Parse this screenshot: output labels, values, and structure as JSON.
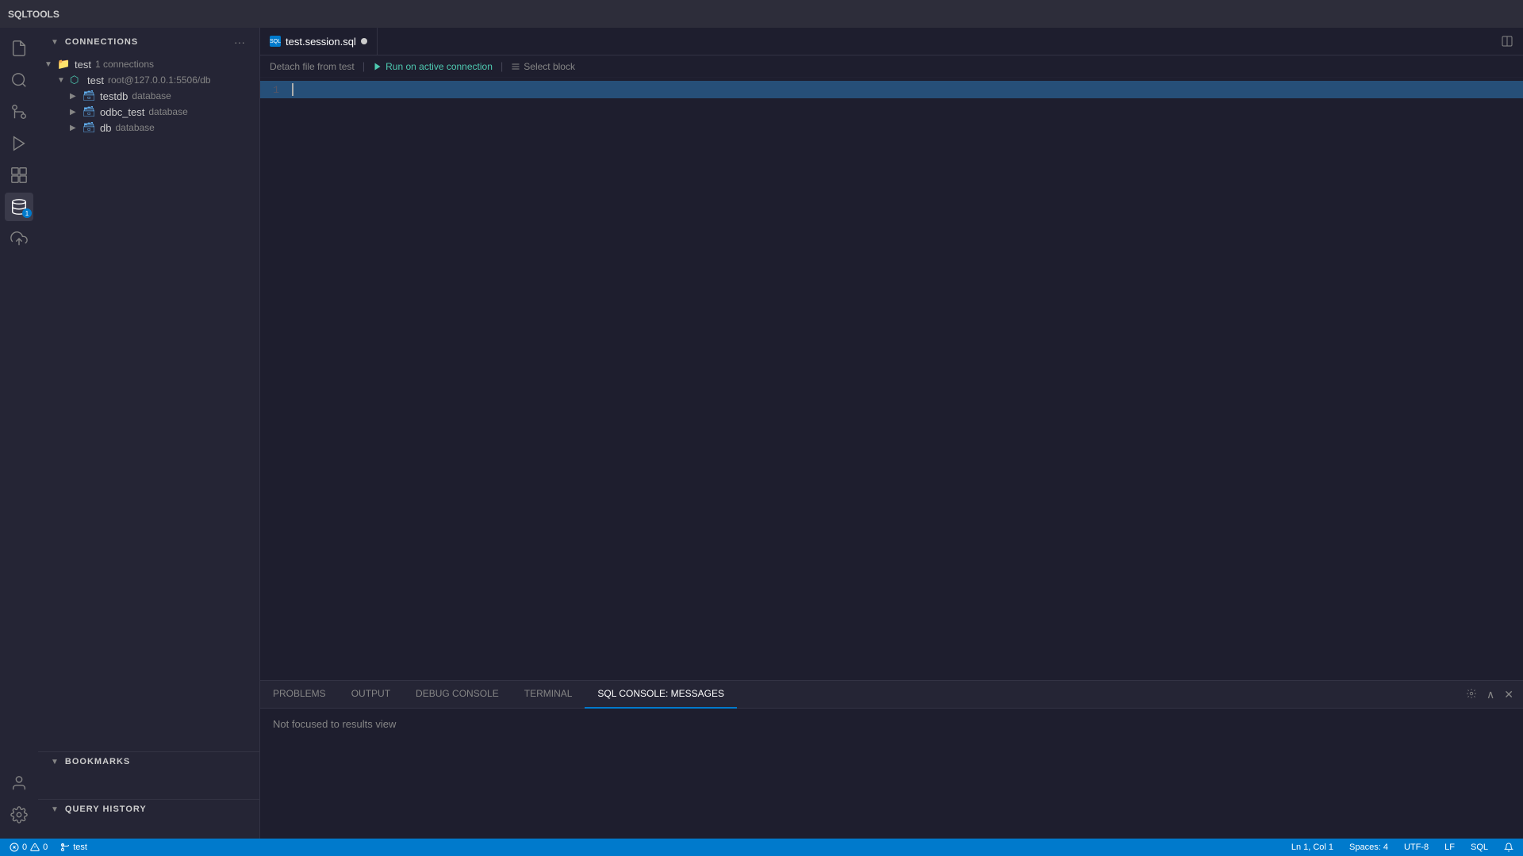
{
  "app": {
    "title": "SQLTOOLS",
    "tab_filename": "test.session.sql",
    "tab_modified": true
  },
  "toolbar": {
    "detach_label": "Detach file from test",
    "run_label": "Run on active connection",
    "select_label": "Select block"
  },
  "sidebar": {
    "connections_title": "CONNECTIONS",
    "bookmarks_title": "BOOKMARKS",
    "query_history_title": "QUERY HISTORY",
    "connections_more_icon": "ellipsis",
    "tree": {
      "test_node": "test",
      "test_connections": "1 connections",
      "test_conn_node": "test",
      "test_conn_host": "root@127.0.0.1:5506/db",
      "testdb_node": "testdb",
      "testdb_type": "database",
      "odbc_test_node": "odbc_test",
      "odbc_test_type": "database",
      "db_node": "db",
      "db_type": "database"
    }
  },
  "editor": {
    "line1_number": "1",
    "line1_content": ""
  },
  "panel": {
    "problems_label": "PROBLEMS",
    "output_label": "OUTPUT",
    "debug_console_label": "DEBUG CONSOLE",
    "terminal_label": "TERMINAL",
    "sql_console_label": "SQL CONSOLE: MESSAGES",
    "message": "Not focused to results view"
  },
  "status_bar": {
    "errors": "0",
    "warnings": "0",
    "branch": "test",
    "position": "Ln 1, Col 1",
    "spaces": "Spaces: 4",
    "encoding": "UTF-8",
    "line_ending": "LF",
    "language": "SQL"
  },
  "activity_icons": [
    {
      "name": "files-icon",
      "symbol": "⎘",
      "active": false
    },
    {
      "name": "search-icon",
      "symbol": "🔍",
      "active": false
    },
    {
      "name": "source-control-icon",
      "symbol": "⑂",
      "active": false
    },
    {
      "name": "run-debug-icon",
      "symbol": "▷",
      "active": false
    },
    {
      "name": "extensions-icon",
      "symbol": "⊞",
      "active": false
    },
    {
      "name": "data-icon",
      "symbol": "🗃",
      "active": true
    },
    {
      "name": "deploy-icon",
      "symbol": "☁",
      "active": false
    }
  ]
}
